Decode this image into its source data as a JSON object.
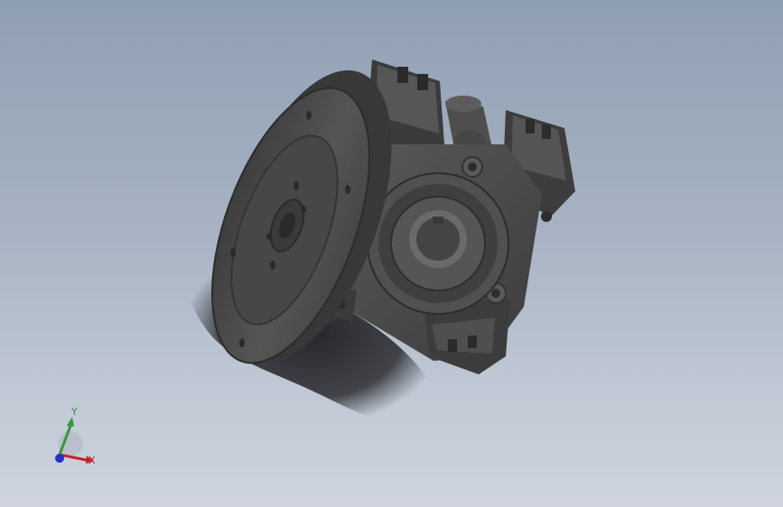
{
  "viewport": {
    "model": "worm-gearbox-assembly",
    "background": {
      "top": "#8f9fb3",
      "bottom": "#cfd4de"
    },
    "part_color": "#4a4a4a"
  },
  "triad": {
    "x_label": "X",
    "y_label": "Y",
    "x_color": "#c4232a",
    "y_color": "#2f9a3a",
    "z_color": "#2033c8"
  }
}
